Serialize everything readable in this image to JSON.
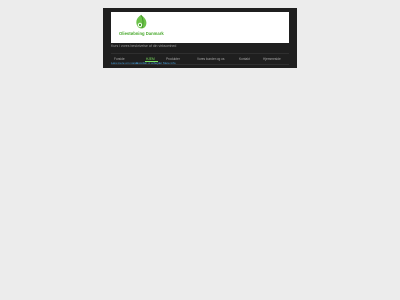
{
  "site": {
    "logo_text": "Oliestøbning Danmark",
    "tagline": "Kurs i vores beskrivelse af din virksomhed"
  },
  "nav": {
    "items": [
      {
        "label": "Forside"
      },
      {
        "label": "HJEM"
      },
      {
        "label": "Produkter"
      },
      {
        "label": "Vores kunder og os"
      },
      {
        "label": "Kontakt"
      },
      {
        "label": "Hjemmeside"
      }
    ],
    "active_index": 1
  },
  "subnav": {
    "items": [
      {
        "label": "Læs mere om vores"
      },
      {
        "label": "Hvordan vi arbejder"
      },
      {
        "label": "Mere info"
      }
    ]
  },
  "colors": {
    "accent_green": "#7be25f",
    "logo_green": "#47a82b",
    "link_blue": "#4aa3df",
    "header_bg": "#1f1f1f"
  }
}
